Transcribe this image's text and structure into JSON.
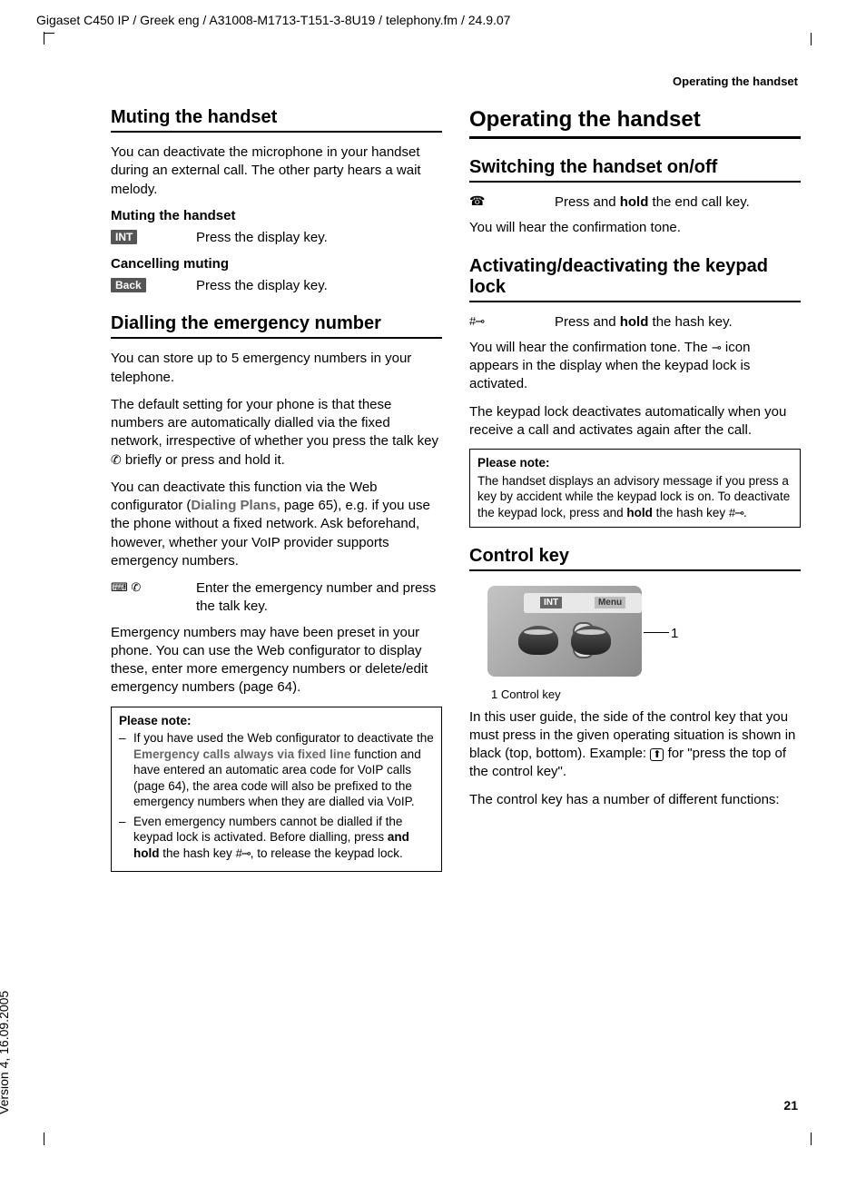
{
  "meta": {
    "top_line": "Gigaset C450 IP / Greek eng / A31008-M1713-T151-3-8U19 / telephony.fm / 24.9.07",
    "version": "Version 4, 16.09.2005",
    "running_header": "Operating the handset",
    "page_number": "21"
  },
  "left": {
    "h_muting": "Muting the handset",
    "p_muting": "You can deactivate the microphone in your handset during an external call. The other party hears a wait melody.",
    "h_muting2": "Muting the handset",
    "int_label": "INT",
    "int_desc": "Press the display key.",
    "h_cancel": "Cancelling muting",
    "back_label": "Back",
    "back_desc": "Press the display key.",
    "h_dial_emerg": "Dialling the emergency number",
    "p_emerg1": "You can store up to 5 emergency numbers in your telephone.",
    "p_emerg2a": "The default setting for your phone is that these numbers are automatically dialled via the fixed network, irrespective of whether you press the talk key ",
    "p_emerg2b": " briefly or press and hold it.",
    "p_emerg3a": "You can deactivate this function via the Web configurator (",
    "dialing_plans": "Dialing Plans,",
    "p_emerg3b": " page 65), e.g. if you use the phone without a fixed network. Ask beforehand, however, whether your VoIP provider supports emergency numbers.",
    "enter_desc": "Enter the emergency number and press the talk key.",
    "p_emerg4": "Emergency numbers may have been preset in your phone. You can use the Web configurator to display these, enter more emergency numbers or delete/edit emergency numbers (page 64).",
    "note_title": "Please note:",
    "note1a": "If you have used the Web configurator to deactivate the ",
    "note1_bold": "Emergency calls always via fixed line",
    "note1b": " function and have entered an automatic area code for VoIP calls (page 64), the area code will also be prefixed to the emergency numbers when they are dialled via VoIP.",
    "note2a": "Even emergency numbers cannot be dialled if the keypad lock is activated. Before dialling, press ",
    "note2_bold": "and hold",
    "note2b": " the hash key ",
    "note2c": ", to release the keypad lock."
  },
  "right": {
    "h_operating": "Operating the handset",
    "h_switching": "Switching the handset on/off",
    "switch_a": "Press and ",
    "switch_hold": "hold",
    "switch_b": " the end call key.",
    "p_switch": "You will hear the confirmation tone.",
    "h_keypad": "Activating/deactivating the keypad lock",
    "keypad_a": "Press and ",
    "keypad_hold": "hold",
    "keypad_b": " the hash key.",
    "p_keypad1a": "You will hear the confirmation tone. The ",
    "p_keypad1b": " icon appears in the display when the keypad lock is activated.",
    "p_keypad2": "The keypad lock deactivates automatically when you receive a call and activates again after the call.",
    "note_title": "Please note:",
    "note_text_a": "The handset displays an advisory message if you press a key by accident while the keypad lock is on. To deactivate the keypad lock, press and ",
    "note_hold": "hold",
    "note_text_b": " the hash key ",
    "note_text_c": ".",
    "h_control": "Control key",
    "ck_int": "INT",
    "ck_menu": "Menu",
    "ck_1": "1",
    "ck_caption": "1 Control key",
    "p_ctrl1a": "In this user guide, the side of the control key that you must press in the given operating situation is shown in black (top, bottom). Example: ",
    "p_ctrl1b": " for \"press the top of the control key\".",
    "p_ctrl2": "The control key has a number of different functions:"
  }
}
